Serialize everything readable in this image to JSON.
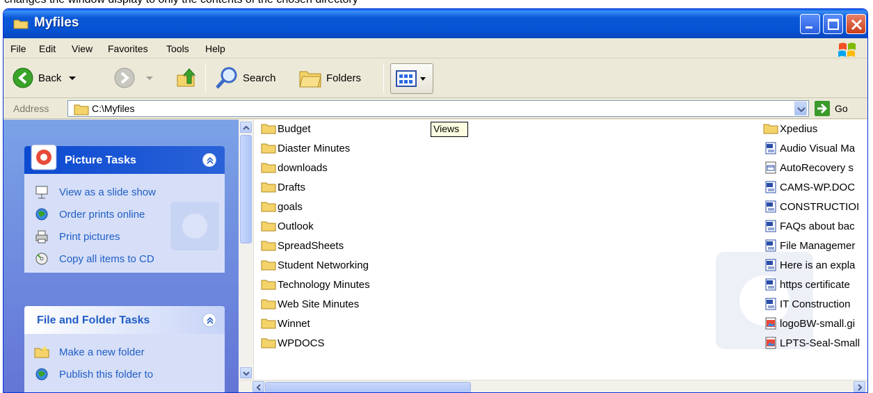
{
  "caption": "changes the window display to only the contents of the chosen directory",
  "window": {
    "title": "Myfiles"
  },
  "menu": [
    "File",
    "Edit",
    "View",
    "Favorites",
    "Tools",
    "Help"
  ],
  "toolbar": {
    "back": "Back",
    "search": "Search",
    "folders": "Folders",
    "views_tooltip": "Views"
  },
  "address": {
    "label": "Address",
    "value": "C:\\Myfiles",
    "go": "Go"
  },
  "picture_tasks": {
    "title": "Picture Tasks",
    "items": [
      "View as a slide show",
      "Order prints online",
      "Print pictures",
      "Copy all items to CD"
    ]
  },
  "file_folder_tasks": {
    "title": "File and Folder Tasks",
    "items": [
      "Make a new folder",
      "Publish this folder to"
    ]
  },
  "files_col1": [
    "Budget",
    "Diaster Minutes",
    "downloads",
    "Drafts",
    "goals",
    "Outlook",
    "SpreadSheets",
    "Student Networking",
    "Technology Minutes",
    "Web Site Minutes",
    "Winnet",
    "WPDOCS"
  ],
  "files_col2": [
    {
      "name": "Xpedius",
      "kind": "folder"
    },
    {
      "name": "Audio Visual Ma",
      "kind": "word"
    },
    {
      "name": "AutoRecovery s",
      "kind": "recovery"
    },
    {
      "name": "CAMS-WP.DOC",
      "kind": "word"
    },
    {
      "name": "CONSTRUCTIOI",
      "kind": "word"
    },
    {
      "name": "FAQs about bac",
      "kind": "word"
    },
    {
      "name": "File Managemer",
      "kind": "word"
    },
    {
      "name": "Here is an expla",
      "kind": "word"
    },
    {
      "name": "https certificate",
      "kind": "word"
    },
    {
      "name": "IT Construction",
      "kind": "word"
    },
    {
      "name": "logoBW-small.gi",
      "kind": "image"
    },
    {
      "name": "LPTS-Seal-Small",
      "kind": "image"
    }
  ]
}
